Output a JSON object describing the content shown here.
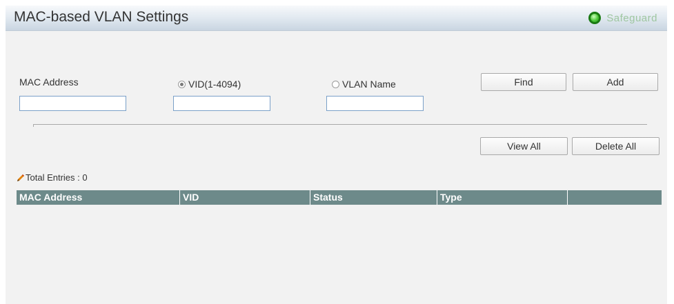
{
  "header": {
    "title": "MAC-based VLAN Settings",
    "safeguard_label": "Safeguard"
  },
  "form": {
    "mac_label": "MAC Address",
    "mac_value": "",
    "vid_label": "VID(1-4094)",
    "vid_checked": true,
    "vid_value": "",
    "vlan_name_label": "VLAN Name",
    "vlan_name_checked": false,
    "vlan_name_value": "",
    "find_label": "Find",
    "add_label": "Add",
    "view_all_label": "View All",
    "delete_all_label": "Delete All"
  },
  "table": {
    "total_entries": "Total Entries : 0",
    "columns": [
      "MAC Address",
      "VID",
      "Status",
      "Type",
      ""
    ],
    "rows": []
  },
  "colors": {
    "table_header": "#6d8a8a",
    "safeguard_icon": "#2a9a1c",
    "input_border": "#7aa0c8"
  }
}
